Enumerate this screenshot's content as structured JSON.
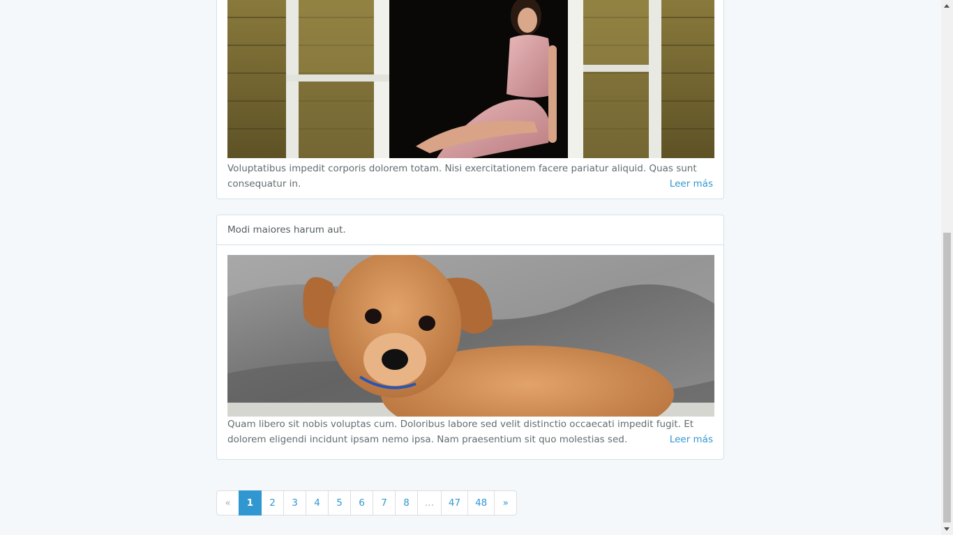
{
  "posts": [
    {
      "image": "woman-in-window-photo",
      "excerpt": "Voluptatibus impedit corporis dolorem totam. Nisi exercitationem facere pariatur aliquid. Quas sunt consequatur in.",
      "read_more": "Leer más"
    },
    {
      "title": "Modi maiores harum aut.",
      "image": "puppy-photo",
      "excerpt": "Quam libero sit nobis voluptas cum. Doloribus labore sed velit distinctio occaecati impedit fugit. Et dolorem eligendi incidunt ipsam nemo ipsa. Nam praesentium sit quo molestias sed.",
      "read_more": "Leer más"
    }
  ],
  "pagination": {
    "prev": "«",
    "pages": [
      "1",
      "2",
      "3",
      "4",
      "5",
      "6",
      "7",
      "8",
      "...",
      "47",
      "48"
    ],
    "active": "1",
    "next": "»"
  },
  "colors": {
    "accent": "#3097d1",
    "background": "#f5f8fa",
    "border": "#d3e0e9"
  }
}
